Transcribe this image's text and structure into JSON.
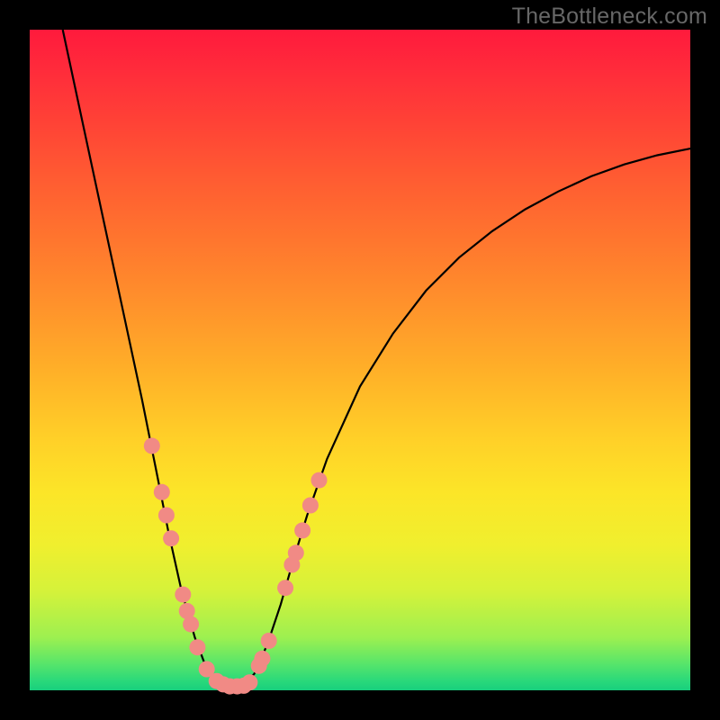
{
  "watermark": "TheBottleneck.com",
  "chart_data": {
    "type": "line",
    "title": "",
    "xlabel": "",
    "ylabel": "",
    "xlim": [
      0,
      100
    ],
    "ylim": [
      0,
      100
    ],
    "grid": false,
    "legend": false,
    "background": "rainbow-vertical",
    "series": [
      {
        "name": "bottleneck-curve",
        "color": "#000000",
        "points": [
          {
            "x": 5.0,
            "y": 100.0
          },
          {
            "x": 8.0,
            "y": 86.0
          },
          {
            "x": 11.0,
            "y": 72.0
          },
          {
            "x": 14.0,
            "y": 58.0
          },
          {
            "x": 17.0,
            "y": 44.0
          },
          {
            "x": 19.0,
            "y": 34.0
          },
          {
            "x": 21.0,
            "y": 24.0
          },
          {
            "x": 23.0,
            "y": 15.0
          },
          {
            "x": 25.0,
            "y": 8.0
          },
          {
            "x": 26.5,
            "y": 4.0
          },
          {
            "x": 28.0,
            "y": 1.5
          },
          {
            "x": 30.0,
            "y": 0.5
          },
          {
            "x": 32.0,
            "y": 0.5
          },
          {
            "x": 34.0,
            "y": 2.5
          },
          {
            "x": 36.0,
            "y": 7.0
          },
          {
            "x": 38.0,
            "y": 13.0
          },
          {
            "x": 40.0,
            "y": 20.0
          },
          {
            "x": 42.0,
            "y": 26.5
          },
          {
            "x": 45.0,
            "y": 35.0
          },
          {
            "x": 50.0,
            "y": 46.0
          },
          {
            "x": 55.0,
            "y": 54.0
          },
          {
            "x": 60.0,
            "y": 60.5
          },
          {
            "x": 65.0,
            "y": 65.5
          },
          {
            "x": 70.0,
            "y": 69.5
          },
          {
            "x": 75.0,
            "y": 72.8
          },
          {
            "x": 80.0,
            "y": 75.5
          },
          {
            "x": 85.0,
            "y": 77.8
          },
          {
            "x": 90.0,
            "y": 79.6
          },
          {
            "x": 95.0,
            "y": 81.0
          },
          {
            "x": 100.0,
            "y": 82.0
          }
        ]
      },
      {
        "name": "measured-markers",
        "color": "#f18a85",
        "type": "scatter",
        "points": [
          {
            "x": 18.5,
            "y": 37.0
          },
          {
            "x": 20.0,
            "y": 30.0
          },
          {
            "x": 20.7,
            "y": 26.5
          },
          {
            "x": 21.4,
            "y": 23.0
          },
          {
            "x": 23.2,
            "y": 14.5
          },
          {
            "x": 23.8,
            "y": 12.0
          },
          {
            "x": 24.4,
            "y": 10.0
          },
          {
            "x": 25.4,
            "y": 6.5
          },
          {
            "x": 26.8,
            "y": 3.2
          },
          {
            "x": 28.3,
            "y": 1.4
          },
          {
            "x": 29.3,
            "y": 0.9
          },
          {
            "x": 30.3,
            "y": 0.6
          },
          {
            "x": 31.4,
            "y": 0.6
          },
          {
            "x": 32.4,
            "y": 0.7
          },
          {
            "x": 33.3,
            "y": 1.2
          },
          {
            "x": 34.7,
            "y": 3.7
          },
          {
            "x": 35.2,
            "y": 4.8
          },
          {
            "x": 36.2,
            "y": 7.5
          },
          {
            "x": 38.7,
            "y": 15.5
          },
          {
            "x": 39.7,
            "y": 19.0
          },
          {
            "x": 40.3,
            "y": 20.8
          },
          {
            "x": 41.3,
            "y": 24.2
          },
          {
            "x": 42.5,
            "y": 28.0
          },
          {
            "x": 43.8,
            "y": 31.8
          }
        ]
      }
    ]
  },
  "colors": {
    "marker": "#f18a85",
    "curve": "#000000",
    "frame": "#000000",
    "watermark": "#676767"
  }
}
